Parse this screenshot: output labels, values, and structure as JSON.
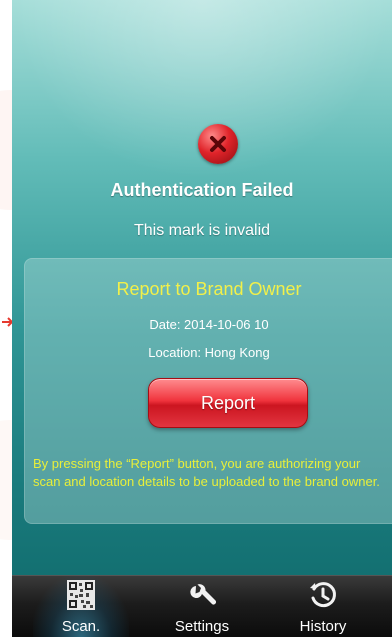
{
  "main": {
    "status_title": "Authentication Failed",
    "status_message": "This mark is invalid"
  },
  "report_panel": {
    "title": "Report to Brand Owner",
    "date": "Date: 2014-10-06 10",
    "location": "Location: Hong Kong",
    "report_button_label": "Report",
    "notice": "By pressing the “Report” button, you are authorizing your scan and location details to be uploaded to the brand owner."
  },
  "tabbar": {
    "active": "scan",
    "items": [
      {
        "id": "scan",
        "label": "Scan.",
        "icon": "qr-code-icon"
      },
      {
        "id": "settings",
        "label": "Settings",
        "icon": "wrench-icon"
      },
      {
        "id": "history",
        "label": "History",
        "icon": "history-clock-icon"
      }
    ]
  },
  "colors": {
    "accent_yellow": "#f2f04a",
    "error_red": "#e0242a",
    "background_teal": "#2f9595",
    "tab_active_glow": "#47b4dc"
  }
}
